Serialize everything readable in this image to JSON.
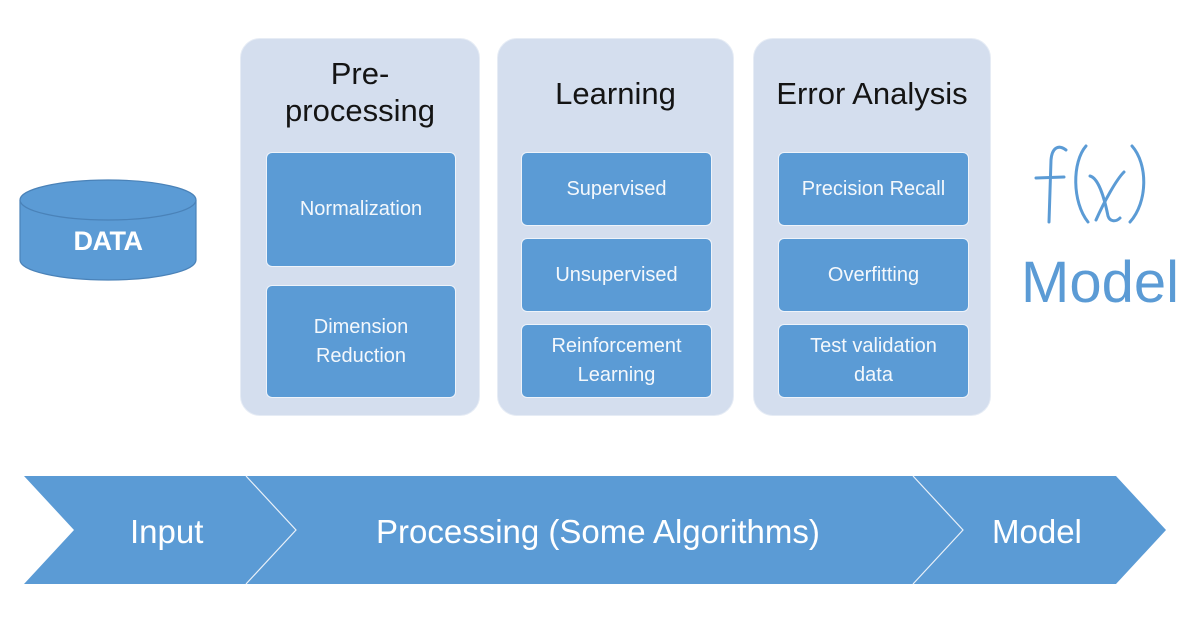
{
  "data_store": {
    "label": "DATA",
    "icon": "database-cylinder-icon"
  },
  "panels": [
    {
      "title": "Pre-\nprocessing",
      "items": [
        "Normalization",
        "Dimension\nReduction"
      ]
    },
    {
      "title": "Learning",
      "items": [
        "Supervised",
        "Unsupervised",
        "Reinforcement\nLearning"
      ]
    },
    {
      "title": "Error Analysis",
      "items": [
        "Precision Recall",
        "Overfitting",
        "Test validation\ndata"
      ]
    }
  ],
  "model": {
    "formula": "f(x)",
    "label": "Model"
  },
  "flow": {
    "steps": [
      "Input",
      "Processing (Some Algorithms)",
      "Model"
    ]
  },
  "colors": {
    "primary": "#5b9bd5",
    "panel": "#d4deee",
    "text_dark": "#141414",
    "white": "#ffffff"
  }
}
